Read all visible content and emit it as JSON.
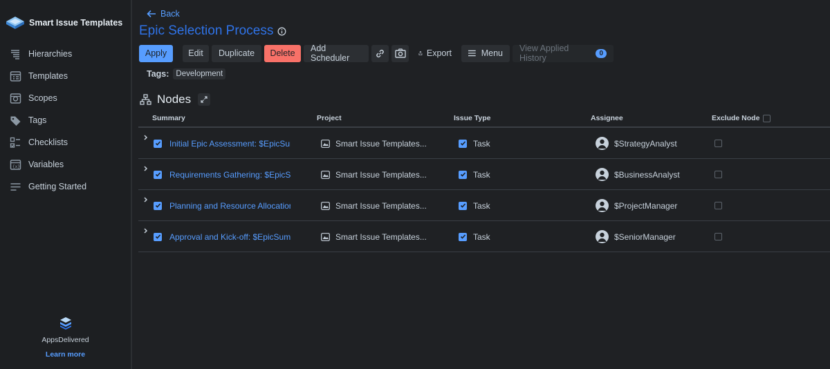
{
  "app": {
    "title": "Smart Issue Templates",
    "nav": [
      {
        "label": "Hierarchies",
        "icon": "hierarchy-icon"
      },
      {
        "label": "Templates",
        "icon": "template-icon"
      },
      {
        "label": "Scopes",
        "icon": "scope-icon"
      },
      {
        "label": "Tags",
        "icon": "tag-icon"
      },
      {
        "label": "Checklists",
        "icon": "checklist-icon"
      },
      {
        "label": "Variables",
        "icon": "variable-icon"
      },
      {
        "label": "Getting Started",
        "icon": "getting-started-icon"
      }
    ],
    "footer": {
      "name": "AppsDelivered",
      "link": "Learn more"
    }
  },
  "header": {
    "back_label": "Back",
    "title": "Epic Selection Process"
  },
  "toolbar": {
    "apply": "Apply",
    "edit": "Edit",
    "duplicate": "Duplicate",
    "delete": "Delete",
    "add_scheduler": "Add Scheduler",
    "export": "Export",
    "menu": "Menu",
    "view_history": "View Applied History",
    "history_count": "0"
  },
  "tags": {
    "label": "Tags:",
    "items": [
      "Development"
    ]
  },
  "nodes": {
    "title": "Nodes",
    "columns": {
      "summary": "Summary",
      "project": "Project",
      "issue_type": "Issue Type",
      "assignee": "Assignee",
      "exclude": "Exclude Node"
    },
    "rows": [
      {
        "summary": "Initial Epic Assessment: $EpicSummary",
        "project": "Smart Issue Templates...",
        "issue_type": "Task",
        "assignee": "$StrategyAnalyst"
      },
      {
        "summary": "Requirements Gathering: $EpicSummary",
        "project": "Smart Issue Templates...",
        "issue_type": "Task",
        "assignee": "$BusinessAnalyst"
      },
      {
        "summary": "Planning and Resource Allocation",
        "project": "Smart Issue Templates...",
        "issue_type": "Task",
        "assignee": "$ProjectManager"
      },
      {
        "summary": "Approval and Kick-off: $EpicSummary",
        "project": "Smart Issue Templates...",
        "issue_type": "Task",
        "assignee": "$SeniorManager"
      }
    ]
  },
  "colors": {
    "accent": "#579dff",
    "title": "#2f73e8",
    "danger": "#f87168",
    "background": "#1f2124"
  }
}
